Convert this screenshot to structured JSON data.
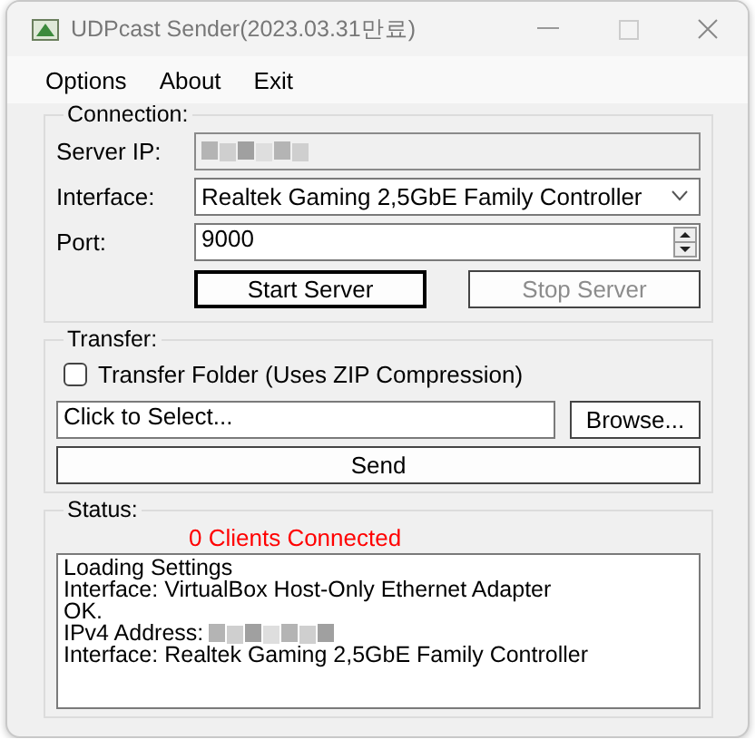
{
  "window": {
    "title": "UDPcast Sender(2023.03.31만료)"
  },
  "menu": [
    "Options",
    "About",
    "Exit"
  ],
  "connection": {
    "legend": "Connection:",
    "server_ip": {
      "label": "Server IP:",
      "redacted": true,
      "disabled": true
    },
    "interface": {
      "label": "Interface:",
      "value": "Realtek Gaming 2,5GbE Family Controller"
    },
    "port": {
      "label": "Port:",
      "value": "9000"
    },
    "buttons": [
      {
        "label": "Start Server",
        "disabled": false,
        "focused": true
      },
      {
        "label": "Stop Server",
        "disabled": true,
        "focused": false
      }
    ]
  },
  "transfer": {
    "legend": "Transfer:",
    "folder_checkbox": {
      "label": "Transfer Folder (Uses ZIP Compression)",
      "checked": false
    },
    "path": {
      "value": "Click to Select..."
    },
    "browse": "Browse...",
    "send": "Send"
  },
  "status": {
    "legend": "Status:",
    "clients": "0 Clients Connected",
    "log": [
      {
        "text": "Loading Settings"
      },
      {
        "text": "Interface: VirtualBox Host-Only Ethernet Adapter"
      },
      {
        "text": "OK."
      },
      {
        "text": "IPv4 Address:",
        "redacted": true
      },
      {
        "text": "Interface: Realtek Gaming 2,5GbE Family Controller"
      }
    ]
  }
}
